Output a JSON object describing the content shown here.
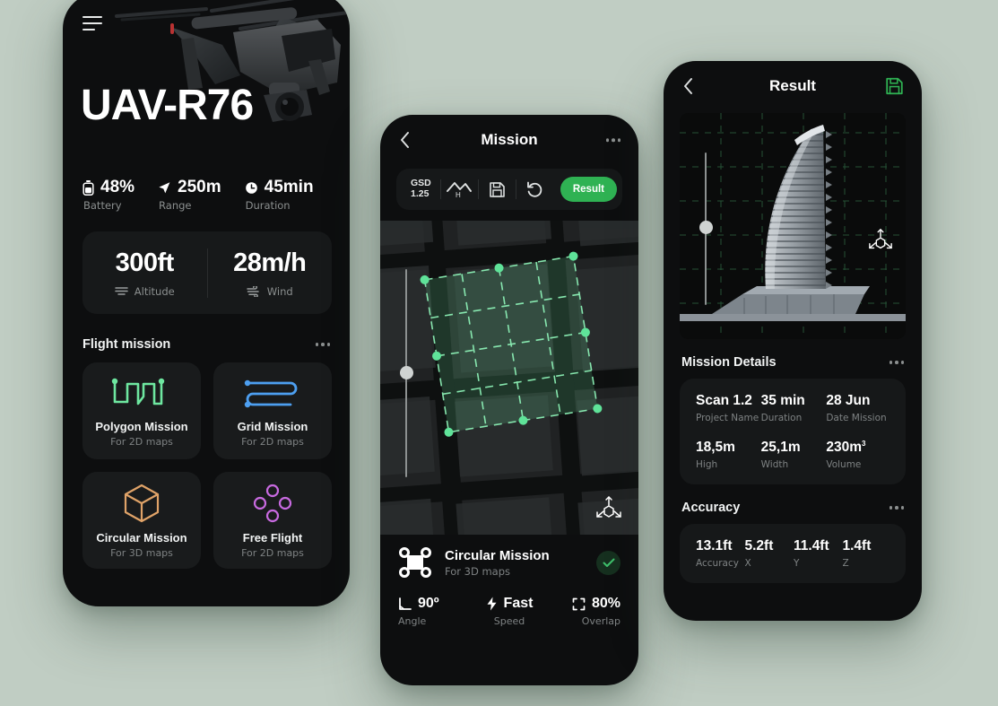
{
  "theme": {
    "page_bg": "#c0cdc3",
    "phone_bg": "#0d0e0f",
    "accent_green": "#2fb253",
    "mint": "#6ee7a0"
  },
  "phone1": {
    "menu_icon": "hamburger-icon",
    "device_name": "UAV-R76",
    "kpis": [
      {
        "icon": "battery-icon",
        "value": "48%",
        "label": "Battery"
      },
      {
        "icon": "navigation-arrow-icon",
        "value": "250m",
        "label": "Range"
      },
      {
        "icon": "clock-icon",
        "value": "45min",
        "label": "Duration"
      }
    ],
    "stats": [
      {
        "value": "300ft",
        "label": "Altitude",
        "icon": "altitude-lines-icon"
      },
      {
        "value": "28m/h",
        "label": "Wind",
        "icon": "wind-icon"
      }
    ],
    "section_title": "Flight mission",
    "missions": [
      {
        "name": "Polygon Mission",
        "sub": "For 2D maps",
        "icon": "polygon-path-icon",
        "color": "#6ee7a0"
      },
      {
        "name": "Grid Mission",
        "sub": "For 2D maps",
        "icon": "grid-path-icon",
        "color": "#4d9ff0"
      },
      {
        "name": "Circular Mission",
        "sub": "For 3D maps",
        "icon": "cube-icon",
        "color": "#e0a368"
      },
      {
        "name": "Free Flight",
        "sub": "For 2D maps",
        "icon": "four-circles-icon",
        "color": "#c86ae0"
      }
    ]
  },
  "phone2": {
    "title": "Mission",
    "back_icon": "chevron-left-icon",
    "more_icon": "more-horizontal-icon",
    "toolbar": {
      "gsd_label": "GSD",
      "gsd_value": "1.25",
      "height_icon": "mountain-height-icon",
      "save_icon": "save-icon",
      "undo_icon": "undo-icon",
      "result_label": "Result"
    },
    "map": {
      "slider_name": "altitude-slider",
      "axis_icon": "3d-axis-icon"
    },
    "selected_mission": {
      "icon": "drone-icon",
      "name": "Circular Mission",
      "sub": "For 3D maps",
      "check_icon": "check-icon",
      "params": [
        {
          "icon": "angle-icon",
          "value": "90º",
          "label": "Angle"
        },
        {
          "icon": "bolt-icon",
          "value": "Fast",
          "label": "Speed"
        },
        {
          "icon": "overlap-icon",
          "value": "80%",
          "label": "Overlap"
        }
      ]
    }
  },
  "phone3": {
    "title": "Result",
    "back_icon": "chevron-left-icon",
    "save_icon": "save-icon",
    "viewer": {
      "slider_name": "model-slider",
      "axis_icon": "3d-axis-icon",
      "model": "building-3d-model"
    },
    "details_title": "Mission Details",
    "details_more_icon": "more-horizontal-icon",
    "details": [
      {
        "value": "Scan 1.2",
        "label": "Project Name"
      },
      {
        "value": "35 min",
        "label": "Duration"
      },
      {
        "value": "28 Jun",
        "label": "Date Mission"
      },
      {
        "value": "18,5m",
        "label": "High"
      },
      {
        "value": "25,1m",
        "label": "Width"
      },
      {
        "value": "230m",
        "sup": "3",
        "label": "Volume"
      }
    ],
    "accuracy_title": "Accuracy",
    "accuracy_more_icon": "more-horizontal-icon",
    "accuracy": [
      {
        "value": "13.1ft",
        "label": "Accuracy"
      },
      {
        "value": "5.2ft",
        "label": "X"
      },
      {
        "value": "11.4ft",
        "label": "Y"
      },
      {
        "value": "1.4ft",
        "label": "Z"
      }
    ]
  }
}
